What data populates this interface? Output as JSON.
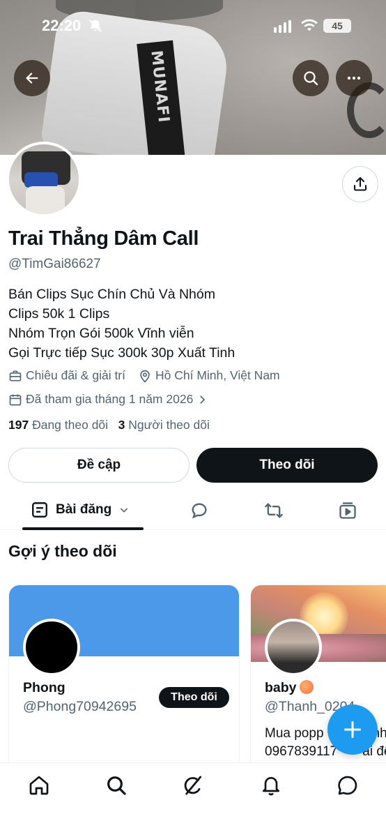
{
  "status_bar": {
    "time": "22:20",
    "battery": "45"
  },
  "header": {
    "back_icon": "arrow-left-icon",
    "search_icon": "search-icon",
    "more_icon": "more-horizontal-icon"
  },
  "profile": {
    "name": "Trai Thẳng Dâm Call",
    "handle": "@TimGai86627",
    "bio_lines": [
      "Bán Clips Sục Chín Chủ Và Nhóm",
      "Clips 50k 1 Clips",
      "Nhóm Trọn Gói 500k Vĩnh viễn",
      "Gọi Trực tiếp Sục 300k 30p Xuất Tinh"
    ],
    "category": "Chiêu đãi & giải trí",
    "location": "Hồ Chí Minh, Việt Nam",
    "joined": "Đã tham gia tháng 1 năm 2026",
    "following_count": "197",
    "following_label": "Đang theo dõi",
    "followers_count": "3",
    "followers_label": "Người theo dõi"
  },
  "actions": {
    "mention_label": "Đề cập",
    "follow_label": "Theo dõi"
  },
  "tabs": {
    "posts_label": "Bài đăng"
  },
  "suggestions": {
    "title": "Gợi ý theo dõi",
    "cards": [
      {
        "name": "Phong",
        "handle": "@Phong70942695",
        "follow_label": "Theo dõi"
      },
      {
        "name": "baby",
        "handle": "@Thanh_0204",
        "bio_lines": [
          "Mua popp",
          "0967839117"
        ],
        "bio_suffix_lines": [
          "nhệ",
          "ai đệ"
        ]
      }
    ]
  },
  "colors": {
    "accent": "#1d9bf0",
    "text_primary": "#0f1419",
    "text_secondary": "#536471",
    "card1_cover": "#4b99e8"
  }
}
